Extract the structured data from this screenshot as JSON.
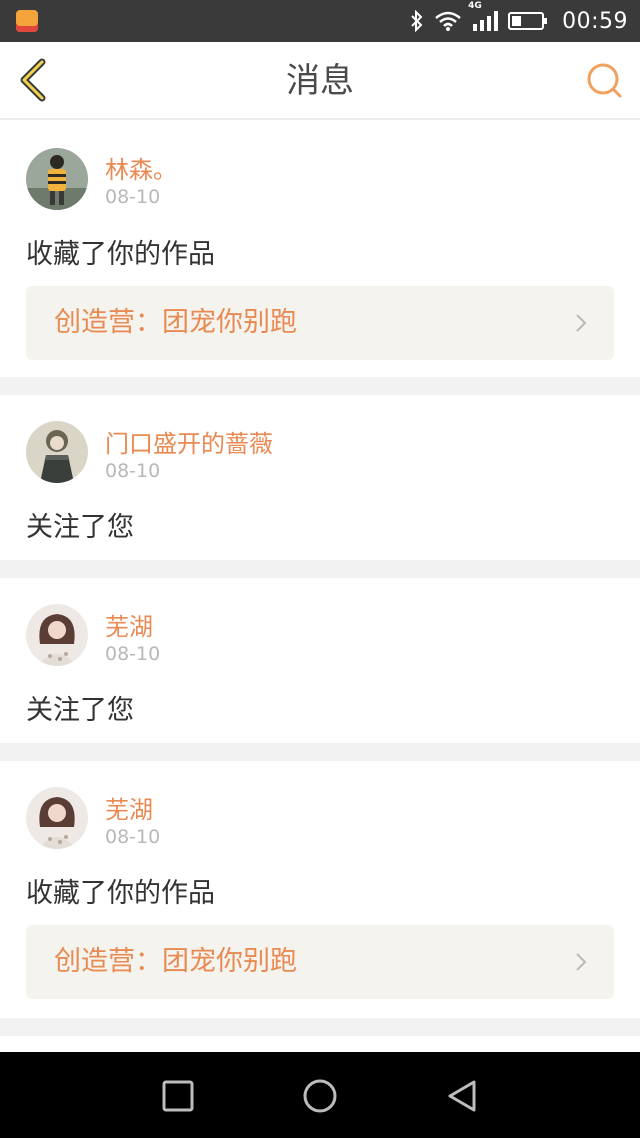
{
  "status_bar": {
    "time": "00:59",
    "network": "4G",
    "icons": [
      "app-icon",
      "bluetooth-icon",
      "wifi-icon",
      "signal-icon",
      "battery-icon"
    ]
  },
  "header": {
    "title": "消息",
    "back_icon": "chevron-left-icon",
    "search_icon": "search-icon",
    "accent": "#E98A53"
  },
  "messages": [
    {
      "user": "林森。",
      "date": "08-10",
      "action": "收藏了你的作品",
      "work": "创造营：团宠你别跑"
    },
    {
      "user": "门口盛开的蔷薇",
      "date": "08-10",
      "action": "关注了您"
    },
    {
      "user": "芜湖",
      "date": "08-10",
      "action": "关注了您"
    },
    {
      "user": "芜湖",
      "date": "08-10",
      "action": "收藏了你的作品",
      "work": "创造营：团宠你别跑"
    }
  ],
  "nav_bar": {
    "buttons": [
      "recents-square-icon",
      "home-circle-icon",
      "back-triangle-icon"
    ]
  }
}
